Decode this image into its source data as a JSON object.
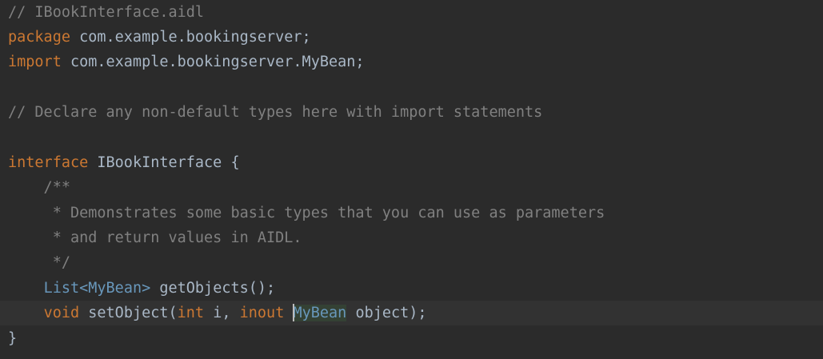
{
  "file_comment": "// IBookInterface.aidl",
  "package_kw": "package",
  "package_name": " com.example.bookingserver;",
  "import_kw": "import",
  "import_name": " com.example.bookingserver.MyBean;",
  "declare_comment": "// Declare any non-default types here with import statements",
  "interface_kw": "interface",
  "interface_decl": " IBookInterface {",
  "doc_open": "    /**",
  "doc_line1": "     * Demonstrates some basic types that you can use as parameters",
  "doc_line2": "     * and return values in AIDL.",
  "doc_close": "     */",
  "m1_indent": "    ",
  "m1_type": "List",
  "m1_generic": "<MyBean>",
  "m1_rest": " getObjects();",
  "m2_indent": "    ",
  "m2_void": "void",
  "m2_name": " setObject(",
  "m2_int": "int",
  "m2_param1": " i, ",
  "m2_inout": "inout",
  "m2_space": " ",
  "m2_type": "MyBean",
  "m2_rest": " object);",
  "closing_brace": "}"
}
